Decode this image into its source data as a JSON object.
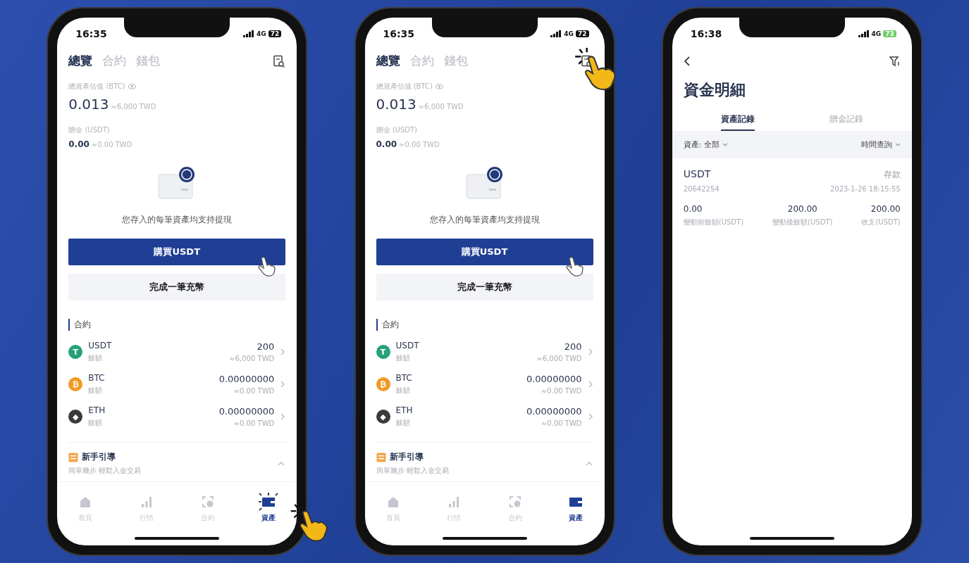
{
  "phones": [
    {
      "kind": "overview",
      "status": {
        "time": "16:35",
        "network": "4G",
        "battery": "72",
        "charging": false
      },
      "tabs": [
        {
          "label": "總覽",
          "selected": true
        },
        {
          "label": "合約",
          "selected": false
        },
        {
          "label": "錢包",
          "selected": false
        }
      ],
      "records_tapped": false,
      "total": {
        "label": "總資產估值 (BTC)",
        "value": "0.013",
        "approx": "≈6,000 TWD"
      },
      "bonus": {
        "label": "贈金 (USDT)",
        "value": "0.00",
        "approx": "≈0.00 TWD"
      },
      "note": "您存入的每筆資產均支持提現",
      "buy_button": {
        "label": "購買USDT",
        "tapped": true
      },
      "deposit_button": "完成一筆充幣",
      "section": "合約",
      "coins": [
        {
          "symbol": "USDT",
          "sub": "餘額",
          "amount": "200",
          "approx": "≈6,000 TWD",
          "color": "#26a17b",
          "glyph": "T"
        },
        {
          "symbol": "BTC",
          "sub": "餘額",
          "amount": "0.00000000",
          "approx": "≈0.00 TWD",
          "color": "#f09a26",
          "glyph": "₿"
        },
        {
          "symbol": "ETH",
          "sub": "餘額",
          "amount": "0.00000000",
          "approx": "≈0.00 TWD",
          "color": "#3a3a3a",
          "glyph": "◆"
        }
      ],
      "guide": {
        "title": "新手引導",
        "subtitle": "簡單幾步 輕鬆入金交易"
      },
      "nav": [
        {
          "label": "首頁",
          "kind": "home",
          "selected": false,
          "tapped": false
        },
        {
          "label": "行情",
          "kind": "chart",
          "selected": false,
          "tapped": false
        },
        {
          "label": "合約",
          "kind": "contract",
          "selected": false,
          "tapped": false
        },
        {
          "label": "資產",
          "kind": "wallet",
          "selected": true,
          "tapped": true
        }
      ]
    },
    {
      "kind": "overview",
      "status": {
        "time": "16:35",
        "network": "4G",
        "battery": "72",
        "charging": false
      },
      "tabs": [
        {
          "label": "總覽",
          "selected": true
        },
        {
          "label": "合約",
          "selected": false
        },
        {
          "label": "錢包",
          "selected": false
        }
      ],
      "records_tapped": true,
      "total": {
        "label": "總資產估值 (BTC)",
        "value": "0.013",
        "approx": "≈6,000 TWD"
      },
      "bonus": {
        "label": "贈金 (USDT)",
        "value": "0.00",
        "approx": "≈0.00 TWD"
      },
      "note": "您存入的每筆資產均支持提現",
      "buy_button": {
        "label": "購買USDT",
        "tapped": true
      },
      "deposit_button": "完成一筆充幣",
      "section": "合約",
      "coins": [
        {
          "symbol": "USDT",
          "sub": "餘額",
          "amount": "200",
          "approx": "≈6,000 TWD",
          "color": "#26a17b",
          "glyph": "T"
        },
        {
          "symbol": "BTC",
          "sub": "餘額",
          "amount": "0.00000000",
          "approx": "≈0.00 TWD",
          "color": "#f09a26",
          "glyph": "₿"
        },
        {
          "symbol": "ETH",
          "sub": "餘額",
          "amount": "0.00000000",
          "approx": "≈0.00 TWD",
          "color": "#3a3a3a",
          "glyph": "◆"
        }
      ],
      "guide": {
        "title": "新手引導",
        "subtitle": "簡單幾步 輕鬆入金交易"
      },
      "nav": [
        {
          "label": "首頁",
          "kind": "home",
          "selected": false,
          "tapped": false
        },
        {
          "label": "行情",
          "kind": "chart",
          "selected": false,
          "tapped": false
        },
        {
          "label": "合約",
          "kind": "contract",
          "selected": false,
          "tapped": false
        },
        {
          "label": "資產",
          "kind": "wallet",
          "selected": true,
          "tapped": false
        }
      ]
    },
    {
      "kind": "details",
      "status": {
        "time": "16:38",
        "network": "4G",
        "battery": "73",
        "charging": true
      },
      "title": "資金明細",
      "tabs": [
        {
          "label": "資產記錄",
          "selected": true
        },
        {
          "label": "贈金記錄",
          "selected": false
        }
      ],
      "filters": {
        "asset": "資產: 全部",
        "time": "時間查詢"
      },
      "record": {
        "symbol": "USDT",
        "type": "存款",
        "id": "20642254",
        "date": "2023-1-26 18:15:55",
        "columns": [
          {
            "value": "0.00",
            "label": "變動前餘額(USDT)"
          },
          {
            "value": "200.00",
            "label": "變動後餘額(USDT)"
          },
          {
            "value": "200.00",
            "label": "收支(USDT)"
          }
        ]
      }
    }
  ]
}
